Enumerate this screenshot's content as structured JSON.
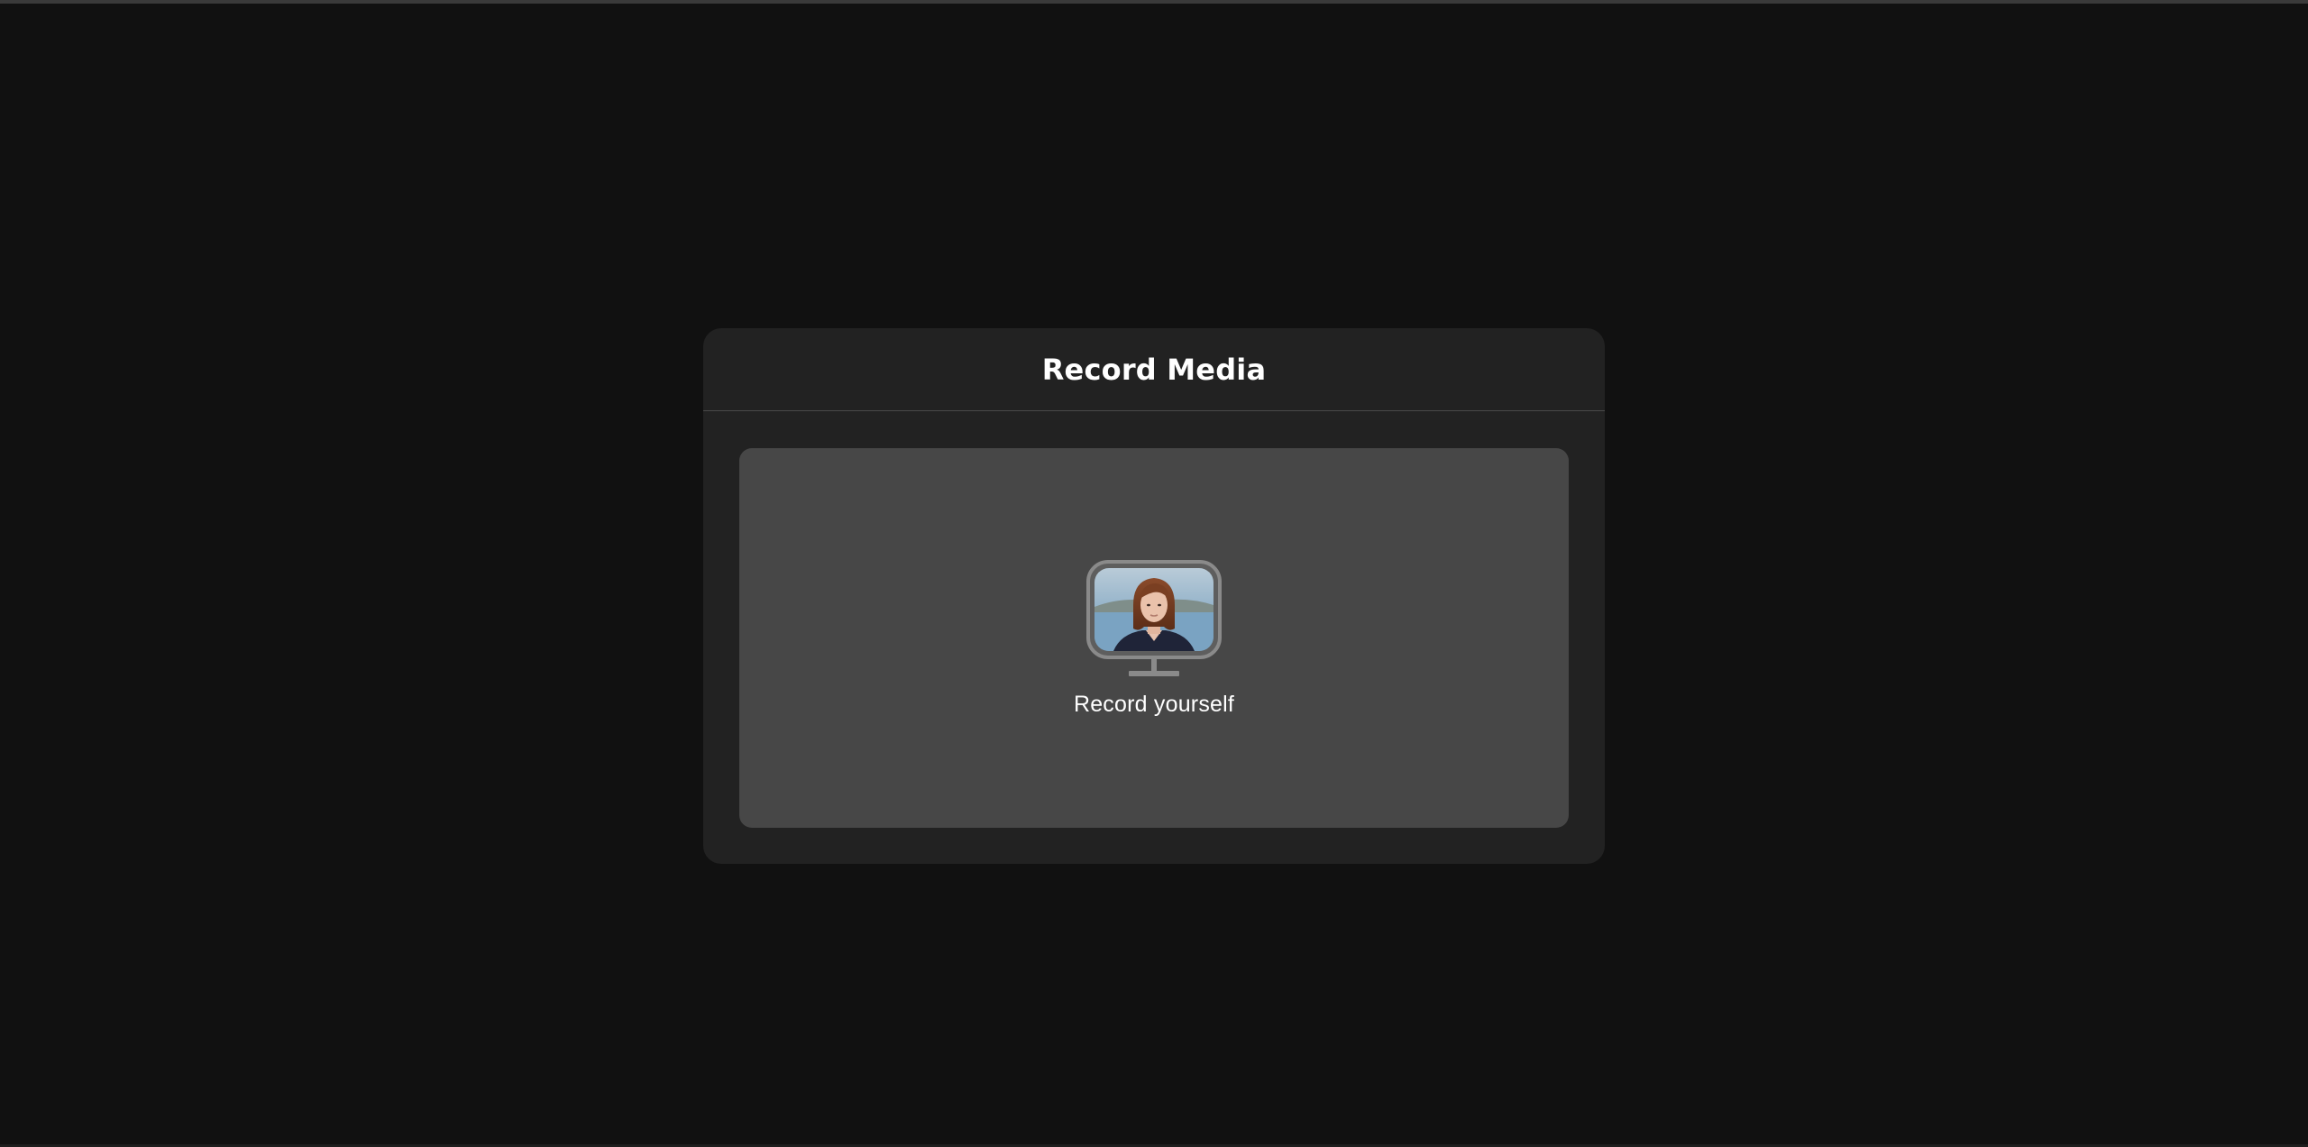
{
  "modal": {
    "title": "Record Media"
  },
  "options": [
    {
      "label": "Record yourself",
      "icon": "monitor-with-person-icon"
    }
  ],
  "colors": {
    "page_background": "#111111",
    "modal_background": "#222222",
    "card_background": "#474747",
    "text": "#ffffff",
    "monitor_frame": "#8a8a8a"
  }
}
